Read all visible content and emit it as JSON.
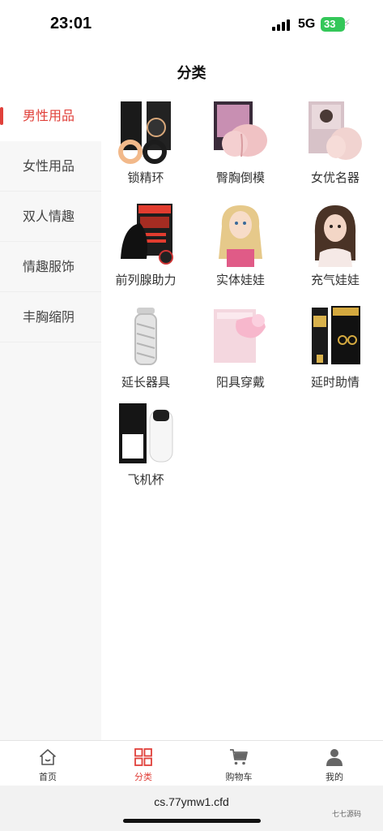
{
  "status_bar": {
    "time": "23:01",
    "network": "5G",
    "battery": "33"
  },
  "header": {
    "title": "分类"
  },
  "sidebar": {
    "items": [
      {
        "label": "男性用品",
        "active": true
      },
      {
        "label": "女性用品",
        "active": false
      },
      {
        "label": "双人情趣",
        "active": false
      },
      {
        "label": "情趣服饰",
        "active": false
      },
      {
        "label": "丰胸缩阴",
        "active": false
      }
    ]
  },
  "categories": [
    {
      "label": "锁精环",
      "icon": "ring-product-icon"
    },
    {
      "label": "臀胸倒模",
      "icon": "mold-product-icon"
    },
    {
      "label": "女优名器",
      "icon": "masturbator-product-icon"
    },
    {
      "label": "前列腺助力",
      "icon": "prostate-product-icon"
    },
    {
      "label": "实体娃娃",
      "icon": "doll-product-icon"
    },
    {
      "label": "充气娃娃",
      "icon": "inflatable-doll-icon"
    },
    {
      "label": "延长器具",
      "icon": "extender-product-icon"
    },
    {
      "label": "阳具穿戴",
      "icon": "wearable-product-icon"
    },
    {
      "label": "延时助情",
      "icon": "delay-spray-icon"
    },
    {
      "label": "飞机杯",
      "icon": "cup-product-icon"
    }
  ],
  "bottom_nav": {
    "items": [
      {
        "label": "首页",
        "icon": "home-icon",
        "active": false
      },
      {
        "label": "分类",
        "icon": "category-grid-icon",
        "active": true
      },
      {
        "label": "购物车",
        "icon": "cart-icon",
        "active": false
      },
      {
        "label": "我的",
        "icon": "user-icon",
        "active": false
      }
    ]
  },
  "url_bar": {
    "url": "cs.77ymw1.cfd"
  },
  "watermark": {
    "text": "七七源码"
  },
  "colors": {
    "accent": "#e0403a",
    "sidebar_bg": "#f7f7f7",
    "battery": "#34c759"
  }
}
